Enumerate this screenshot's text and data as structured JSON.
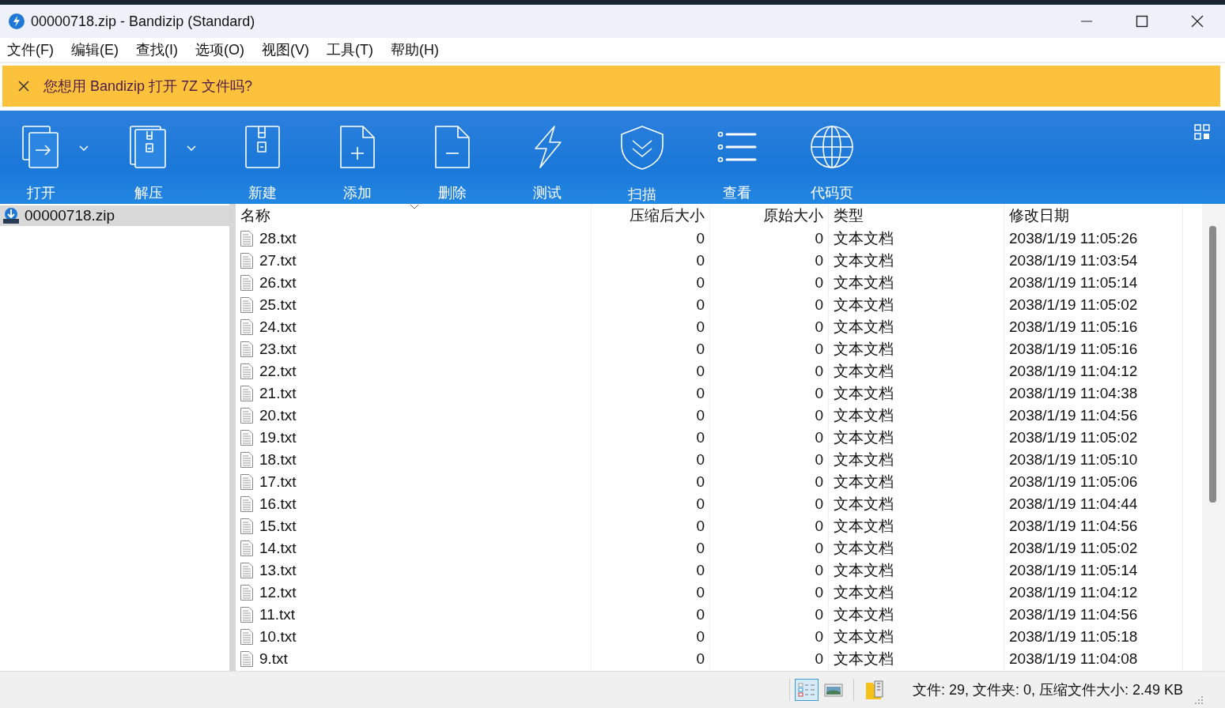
{
  "window": {
    "title": "00000718.zip - Bandizip (Standard)"
  },
  "menu": [
    "文件(F)",
    "编辑(E)",
    "查找(I)",
    "选项(O)",
    "视图(V)",
    "工具(T)",
    "帮助(H)"
  ],
  "banner": {
    "message": "您想用 Bandizip 打开 7Z 文件吗?"
  },
  "toolbar": [
    {
      "kind": "open",
      "label": "打开",
      "dropdown": true
    },
    {
      "kind": "extract",
      "label": "解压",
      "dropdown": true
    },
    {
      "kind": "new",
      "label": "新建",
      "dropdown": false
    },
    {
      "kind": "add",
      "label": "添加",
      "dropdown": false
    },
    {
      "kind": "delete",
      "label": "删除",
      "dropdown": false
    },
    {
      "kind": "test",
      "label": "测试",
      "dropdown": false
    },
    {
      "kind": "scan",
      "label": "扫描",
      "dropdown": false
    },
    {
      "kind": "view",
      "label": "查看",
      "dropdown": false
    },
    {
      "kind": "codepage",
      "label": "代码页",
      "dropdown": false
    }
  ],
  "tree": {
    "items": [
      {
        "label": "00000718.zip",
        "selected": true
      }
    ]
  },
  "table": {
    "columns": [
      {
        "label": "名称",
        "sorted": true
      },
      {
        "label": "压缩后大小",
        "sorted": false
      },
      {
        "label": "原始大小",
        "sorted": false
      },
      {
        "label": "类型",
        "sorted": false
      },
      {
        "label": "修改日期",
        "sorted": false
      }
    ],
    "rows": [
      [
        "28.txt",
        "0",
        "0",
        "文本文档",
        "2038/1/19 11:05:26"
      ],
      [
        "27.txt",
        "0",
        "0",
        "文本文档",
        "2038/1/19 11:03:54"
      ],
      [
        "26.txt",
        "0",
        "0",
        "文本文档",
        "2038/1/19 11:05:14"
      ],
      [
        "25.txt",
        "0",
        "0",
        "文本文档",
        "2038/1/19 11:05:02"
      ],
      [
        "24.txt",
        "0",
        "0",
        "文本文档",
        "2038/1/19 11:05:16"
      ],
      [
        "23.txt",
        "0",
        "0",
        "文本文档",
        "2038/1/19 11:05:16"
      ],
      [
        "22.txt",
        "0",
        "0",
        "文本文档",
        "2038/1/19 11:04:12"
      ],
      [
        "21.txt",
        "0",
        "0",
        "文本文档",
        "2038/1/19 11:04:38"
      ],
      [
        "20.txt",
        "0",
        "0",
        "文本文档",
        "2038/1/19 11:04:56"
      ],
      [
        "19.txt",
        "0",
        "0",
        "文本文档",
        "2038/1/19 11:05:02"
      ],
      [
        "18.txt",
        "0",
        "0",
        "文本文档",
        "2038/1/19 11:05:10"
      ],
      [
        "17.txt",
        "0",
        "0",
        "文本文档",
        "2038/1/19 11:05:06"
      ],
      [
        "16.txt",
        "0",
        "0",
        "文本文档",
        "2038/1/19 11:04:44"
      ],
      [
        "15.txt",
        "0",
        "0",
        "文本文档",
        "2038/1/19 11:04:56"
      ],
      [
        "14.txt",
        "0",
        "0",
        "文本文档",
        "2038/1/19 11:05:02"
      ],
      [
        "13.txt",
        "0",
        "0",
        "文本文档",
        "2038/1/19 11:05:14"
      ],
      [
        "12.txt",
        "0",
        "0",
        "文本文档",
        "2038/1/19 11:04:12"
      ],
      [
        "11.txt",
        "0",
        "0",
        "文本文档",
        "2038/1/19 11:04:56"
      ],
      [
        "10.txt",
        "0",
        "0",
        "文本文档",
        "2038/1/19 11:05:18"
      ],
      [
        "9.txt",
        "0",
        "0",
        "文本文档",
        "2038/1/19 11:04:08"
      ]
    ]
  },
  "status_bar": {
    "views": [
      {
        "kind": "details",
        "selected": true
      },
      {
        "kind": "preview",
        "selected": false
      }
    ],
    "summary": "文件: 29, 文件夹: 0, 压缩文件大小: 2.49 KB"
  }
}
